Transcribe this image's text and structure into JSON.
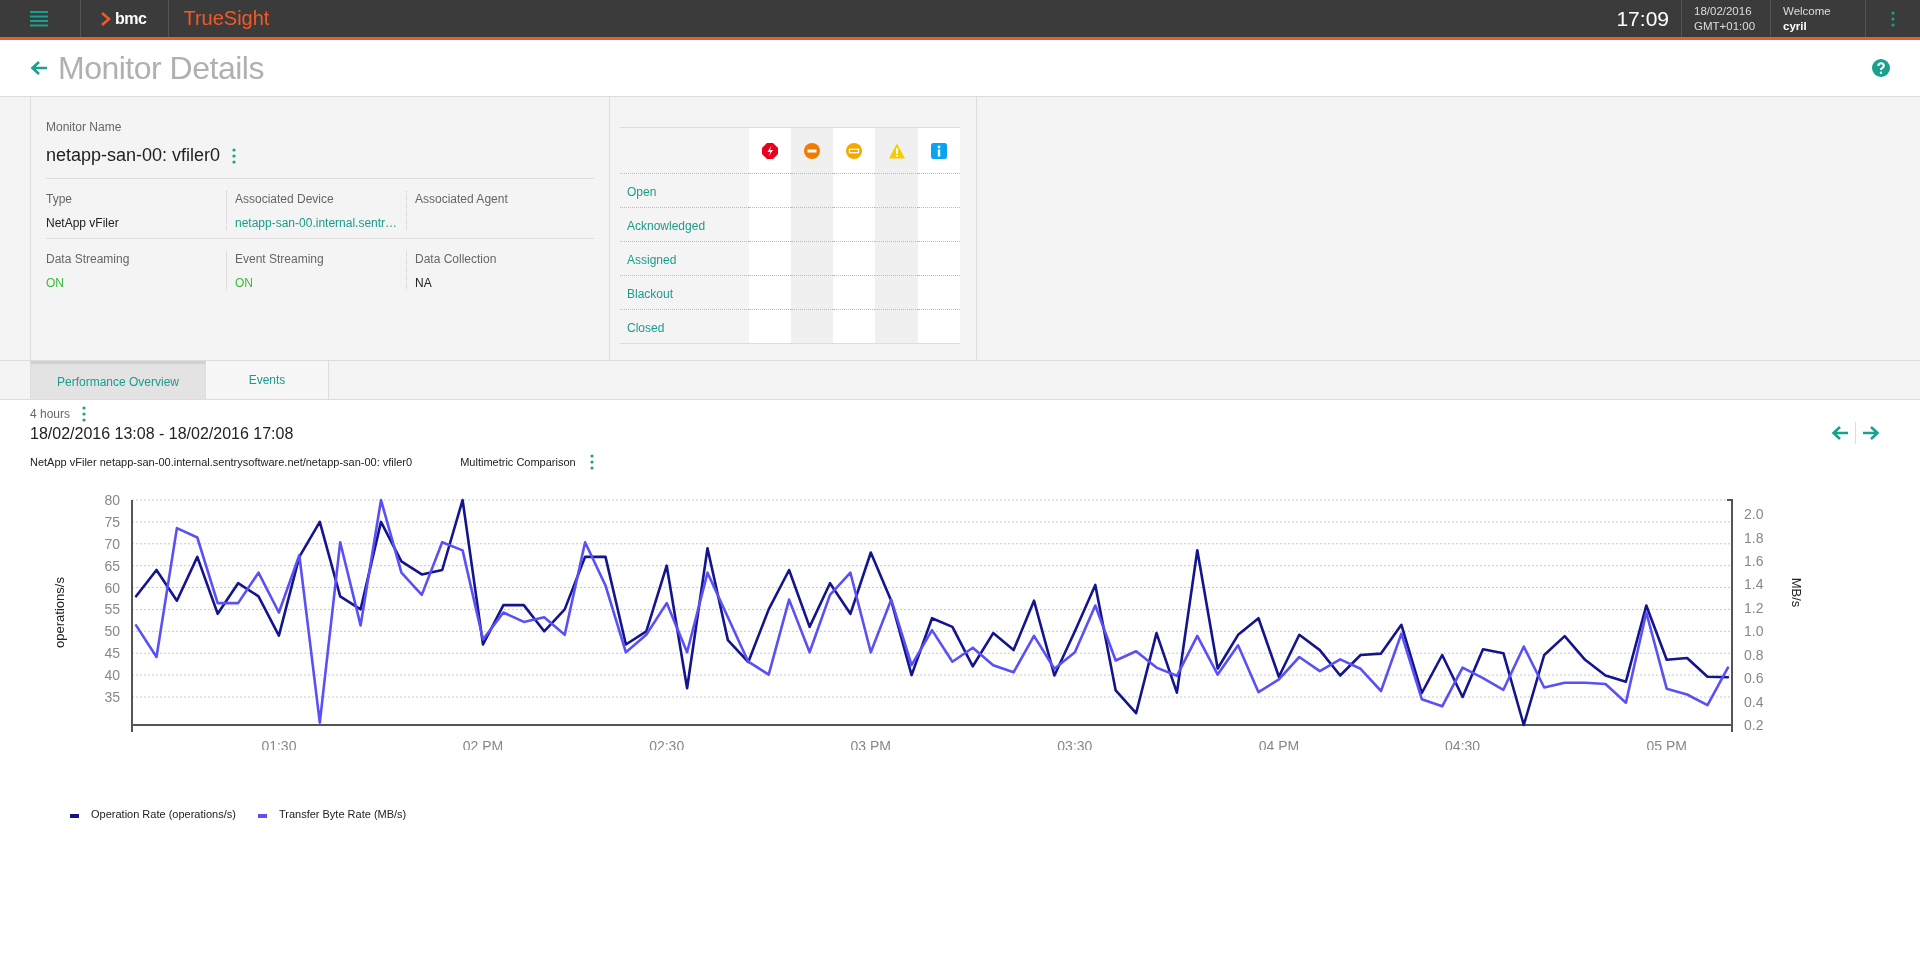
{
  "header": {
    "product": "TrueSight",
    "brand": "bmc",
    "time": "17:09",
    "date": "18/02/2016",
    "timezone": "GMT+01:00",
    "welcome": "Welcome",
    "user": "cyril"
  },
  "page": {
    "title": "Monitor Details"
  },
  "monitor": {
    "name_label": "Monitor Name",
    "name": "netapp-san-00: vfiler0",
    "fields": [
      {
        "label": "Type",
        "value": "NetApp vFiler",
        "kind": "text"
      },
      {
        "label": "Associated Device",
        "value": "netapp-san-00.internal.sentr…",
        "kind": "link"
      },
      {
        "label": "Associated Agent"
      },
      {
        "label": "Data Streaming",
        "value": "ON",
        "kind": "status"
      },
      {
        "label": "Event Streaming",
        "value": "ON",
        "kind": "status"
      },
      {
        "label": "Data Collection",
        "value": "NA",
        "kind": "text"
      }
    ]
  },
  "events": {
    "severities": [
      {
        "kind": "critical"
      },
      {
        "kind": "major"
      },
      {
        "kind": "minor"
      },
      {
        "kind": "warning"
      },
      {
        "kind": "info"
      }
    ],
    "rows": [
      {
        "label": "Open"
      },
      {
        "label": "Acknowledged"
      },
      {
        "label": "Assigned"
      },
      {
        "label": "Blackout"
      },
      {
        "label": "Closed"
      }
    ]
  },
  "tabs": [
    {
      "label": "Performance Overview",
      "selected": true
    },
    {
      "label": "Events",
      "selected": false
    }
  ],
  "performance": {
    "period": "4 hours",
    "range": "18/02/2016 13:08 - 18/02/2016 17:08",
    "source": "NetApp vFiler netapp-san-00.internal.sentrysoftware.net/netapp-san-00: vfiler0",
    "view": "Multimetric Comparison",
    "axes": [
      {
        "chart_data": {
          "type": "line",
          "ylabel": "operations/s",
          "grid": true,
          "categories": [
            null,
            null,
            null,
            null,
            null,
            null,
            null,
            "01:30",
            null,
            null,
            null,
            null,
            null,
            null,
            null,
            null,
            null,
            "02 PM",
            null,
            null,
            null,
            null,
            null,
            null,
            null,
            null,
            "02:30",
            null,
            null,
            null,
            null,
            null,
            null,
            null,
            null,
            null,
            "03 PM",
            null,
            null,
            null,
            null,
            null,
            null,
            null,
            null,
            null,
            "03:30",
            null,
            null,
            null,
            null,
            null,
            null,
            null,
            null,
            null,
            "04 PM",
            null,
            null,
            null,
            null,
            null,
            null,
            null,
            null,
            "04:30",
            null,
            null,
            null,
            null,
            null,
            null,
            null,
            null,
            null,
            "05 PM",
            null,
            null,
            null
          ],
          "ylim": [
            28.6,
            80
          ],
          "yticks": [
            35,
            40,
            45,
            50,
            55,
            60,
            65,
            70,
            75,
            80
          ],
          "series": [
            {
              "name": "Operation Rate (operations/s)",
              "color": "#14148c",
              "values": [
                58,
                64,
                57,
                67,
                54,
                61,
                58,
                49,
                67,
                75,
                58,
                55,
                75,
                66,
                63,
                64,
                80,
                47,
                56,
                56,
                50,
                55,
                67,
                67,
                47,
                50,
                65,
                37,
                69,
                48,
                43,
                55,
                64,
                51,
                61,
                54,
                68,
                57,
                40,
                53,
                51,
                42,
                49.6,
                45.7,
                57,
                39.9,
                50,
                60.6,
                36.5,
                31.3,
                49.6,
                36,
                68.5,
                41.5,
                49.2,
                53,
                39.6,
                49.2,
                45.7,
                39.9,
                44.6,
                44.9,
                51.5,
                35.9,
                44.6,
                35,
                45.9,
                45,
                28.6,
                44.6,
                48.9,
                43.5,
                39.9,
                38.5,
                55.9,
                43.5,
                43.9,
                39.6,
                39.5
              ]
            }
          ]
        }
      },
      {
        "chart_data": {
          "type": "line",
          "ylabel": "MB/s",
          "ylim": [
            0.2,
            2.12
          ],
          "yticks": [
            {
              "value": 0.2,
              "label": "0.2"
            },
            {
              "value": 0.4,
              "label": "0.4"
            },
            {
              "value": 0.6,
              "label": "0.6"
            },
            {
              "value": 0.8,
              "label": "0.8"
            },
            {
              "value": 1,
              "label": "1.0"
            },
            {
              "value": 1.2,
              "label": "1.2"
            },
            {
              "value": 1.4,
              "label": "1.4"
            },
            {
              "value": 1.6,
              "label": "1.6"
            },
            {
              "value": 1.8,
              "label": "1.8"
            },
            {
              "value": 2,
              "label": "2.0"
            }
          ],
          "series": [
            {
              "name": "Transfer Byte Rate (MB/s)",
              "color": "#5a50f5",
              "values": [
                1.05,
                0.78,
                1.88,
                1.8,
                1.24,
                1.24,
                1.5,
                1.16,
                1.65,
                0.22,
                1.76,
                1.05,
                2.12,
                1.5,
                1.31,
                1.76,
                1.69,
                0.93,
                1.16,
                1.08,
                1.12,
                0.97,
                1.76,
                1.39,
                0.82,
                0.97,
                1.24,
                0.82,
                1.5,
                1.12,
                0.74,
                0.63,
                1.27,
                0.82,
                1.31,
                1.5,
                0.82,
                1.27,
                0.71,
                1.01,
                0.74,
                0.86,
                0.71,
                0.65,
                0.96,
                0.68,
                0.82,
                1.22,
                0.75,
                0.83,
                0.69,
                0.62,
                0.96,
                0.63,
                0.88,
                0.48,
                0.59,
                0.78,
                0.66,
                0.76,
                0.68,
                0.49,
                0.98,
                0.42,
                0.36,
                0.69,
                0.6,
                0.5,
                0.87,
                0.52,
                0.56,
                0.56,
                0.55,
                0.39,
                1.16,
                0.51,
                0.46,
                0.37,
                0.69
              ]
            }
          ]
        }
      }
    ]
  }
}
